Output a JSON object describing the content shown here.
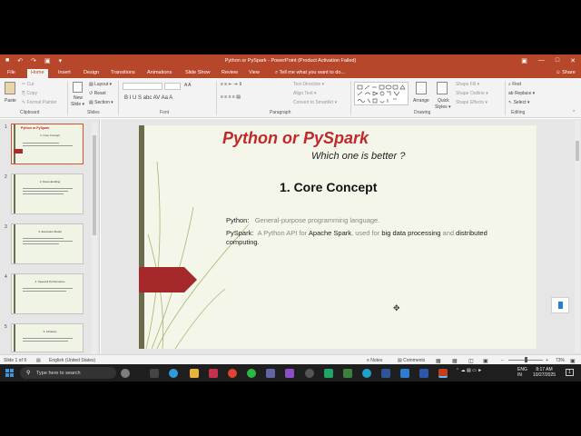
{
  "titlebar": {
    "qat": [
      "■",
      "↶",
      "↷",
      "▣",
      "▾"
    ],
    "title": "Python or PySpark - PowerPoint (Product Activation Failed)",
    "window_controls": [
      "▣",
      "—",
      "□",
      "✕"
    ]
  },
  "tabs": {
    "items": [
      "File",
      "Home",
      "Insert",
      "Design",
      "Transitions",
      "Animations",
      "Slide Show",
      "Review",
      "View"
    ],
    "active": "Home",
    "tell_me": "⌕ Tell me what you want to do...",
    "share": "☺ Share"
  },
  "ribbon": {
    "clipboard": {
      "paste": "Paste",
      "cut": "✂ Cut",
      "copy": "⎘ Copy",
      "format_painter": "✎ Format Painter",
      "label": "Clipboard"
    },
    "slides": {
      "new_slide": "New",
      "new_slide2": "Slide ▾",
      "layout": "▤ Layout ▾",
      "reset": "↺ Reset",
      "section": "▤ Section ▾",
      "label": "Slides"
    },
    "font": {
      "label": "Font",
      "buttons": "B  I  U  S  abc  AV  Aa  A"
    },
    "paragraph": {
      "label": "Paragraph",
      "text_direction": "Text Direction ▾",
      "align_text": "Align Text ▾",
      "smartart": "Convert to SmartArt ▾"
    },
    "drawing": {
      "label": "Drawing",
      "arrange": "Arrange",
      "quick_styles": "Quick",
      "quick_styles2": "Styles ▾",
      "shape_fill": "Shape Fill ▾",
      "shape_outline": "Shape Outline ▾",
      "shape_effects": "Shape Effects ▾"
    },
    "editing": {
      "label": "Editing",
      "find": "⌕ Find",
      "replace": "ab Replace ▾",
      "select": "↖ Select ▾"
    }
  },
  "thumbnails": [
    {
      "num": "1",
      "title": "Python or PySpark",
      "line": "1. Core Concept"
    },
    {
      "num": "2",
      "title": "2. Data Handling",
      "line": ""
    },
    {
      "num": "3",
      "title": "3. Execution Model",
      "line": ""
    },
    {
      "num": "4",
      "title": "4. Speed & Performance",
      "line": ""
    },
    {
      "num": "5",
      "title": "5. Libraries",
      "line": ""
    }
  ],
  "slide": {
    "title": "Python or PySpark",
    "subtitle": "Which one is better ?",
    "heading": "1. Core Concept",
    "python_label": "Python:",
    "python_text": "General-purpose programming language.",
    "pyspark_label": "PySpark:",
    "pyspark_text_a": "A Python API for",
    "pyspark_text_b": "Apache Spark",
    "pyspark_text_c": ", used for",
    "pyspark_text_d": "big data processing",
    "pyspark_text_e": "and",
    "pyspark_text_f": "distributed computing."
  },
  "statusbar": {
    "slide_of": "Slide 1 of 9",
    "language": "English (United States)",
    "notes": "≡ Notes",
    "comments": "▤ Comments",
    "zoom_minus": "−",
    "zoom_plus": "+",
    "zoom": "73%"
  },
  "taskbar": {
    "search_placeholder": "Type here to search",
    "lang_1": "ENG",
    "lang_2": "IN",
    "time": "8:17 AM",
    "date": "10/27/2025",
    "notif": "1"
  },
  "colors": {
    "accent": "#b7472a",
    "title_red": "#c0282a",
    "slide_bg": "#f4f6ea"
  }
}
